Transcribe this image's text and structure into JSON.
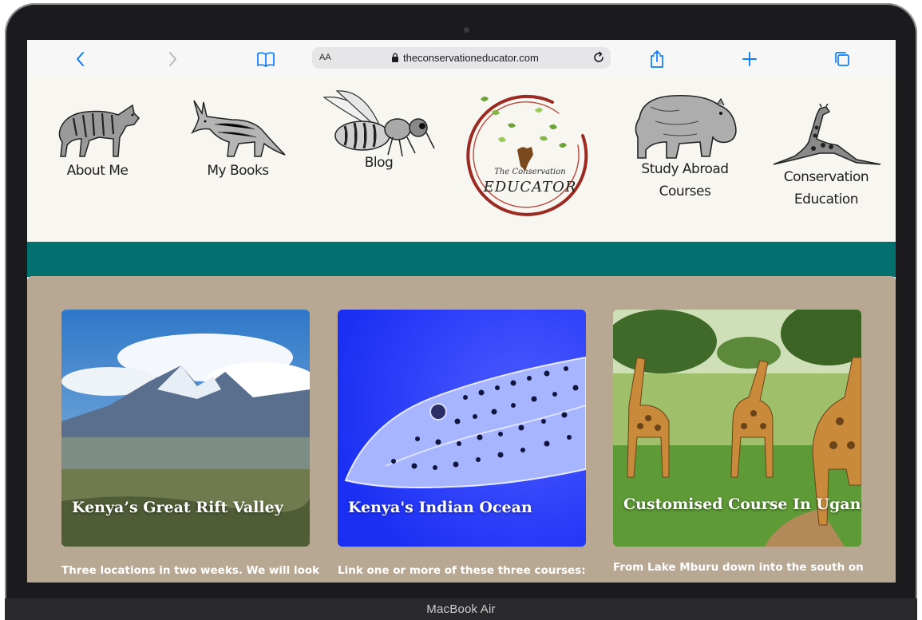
{
  "device": {
    "label": "MacBook Air"
  },
  "browser": {
    "text_size_label": "AA",
    "url": "theconservationeducator.com"
  },
  "site": {
    "logo": {
      "line1": "The Conservation",
      "line2": "EDUCATOR"
    },
    "nav": [
      {
        "label": "About Me"
      },
      {
        "label": "My Books"
      },
      {
        "label": "Blog"
      },
      {
        "label_line1": "Study Abroad",
        "label_line2": "Courses"
      },
      {
        "label_line1": "Conservation",
        "label_line2": "Education"
      }
    ]
  },
  "courses": [
    {
      "title": "Kenya’s Great Rift Valley",
      "description": "Three locations in two weeks. We will look"
    },
    {
      "title": "Kenya's Indian Ocean",
      "description": "Link one or more of these three courses:"
    },
    {
      "title": "Customised Course In Uganda",
      "description": "From Lake Mburu down into the south on"
    }
  ],
  "colors": {
    "teal_band": "#02706e",
    "content_bg": "#b8a893",
    "header_bg": "#f8f6f1",
    "safari_blue": "#0a7aff",
    "logo_ring": "#9b2a22"
  }
}
